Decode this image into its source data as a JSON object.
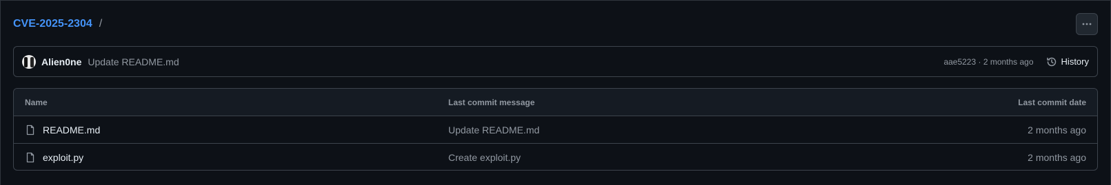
{
  "breadcrumb": {
    "repo": "CVE-2025-2304",
    "separator": "/"
  },
  "more_button": {
    "icon": "kebab-horizontal-icon"
  },
  "latest_commit": {
    "author": "Alien0ne",
    "message": "Update README.md",
    "sha_and_time": "aae5223 · 2 months ago",
    "history_label": "History"
  },
  "file_table": {
    "headers": {
      "name": "Name",
      "message": "Last commit message",
      "date": "Last commit date"
    },
    "rows": [
      {
        "name": "README.md",
        "message": "Update README.md",
        "date": "2 months ago",
        "icon": "file-icon"
      },
      {
        "name": "exploit.py",
        "message": "Create exploit.py",
        "date": "2 months ago",
        "icon": "file-icon"
      }
    ]
  },
  "colors": {
    "link": "#4493f8",
    "background": "#0d1117",
    "border": "#3d444d",
    "muted": "#9198a1"
  }
}
